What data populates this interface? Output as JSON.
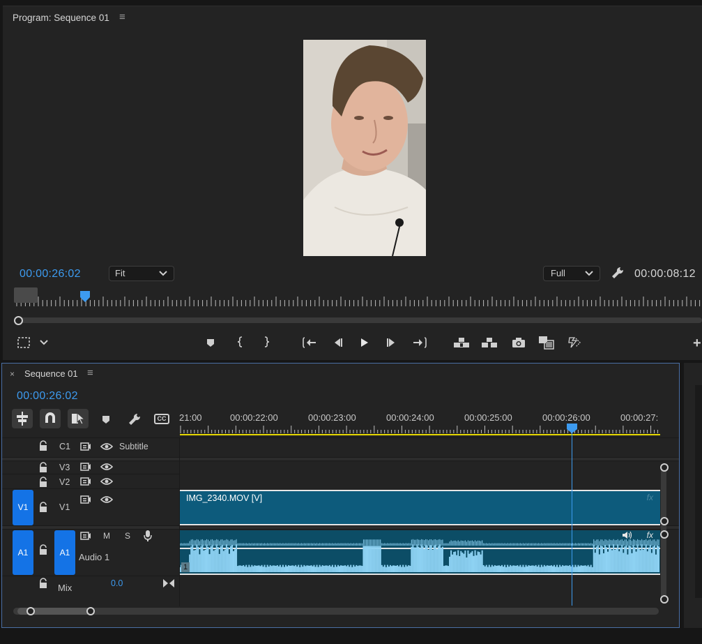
{
  "program": {
    "title": "Program: Sequence 01",
    "current_time": "00:00:26:02",
    "zoom_select": "Fit",
    "resolution_select": "Full",
    "duration": "00:00:08:12",
    "playhead_fraction": 0.105
  },
  "timeline": {
    "sequence_tab": "Sequence 01",
    "current_time": "00:00:26:02",
    "ruler_labels": [
      "21:00",
      "00:00:22:00",
      "00:00:23:00",
      "00:00:24:00",
      "00:00:25:00",
      "00:00:26:00",
      "00:00:27:"
    ],
    "tracks": {
      "c1": {
        "label": "C1",
        "name": "Subtitle"
      },
      "v3": {
        "label": "V3"
      },
      "v2": {
        "label": "V2"
      },
      "v1": {
        "source": "V1",
        "label": "V1"
      },
      "a1": {
        "source": "A1",
        "label": "A1",
        "name": "Audio 1",
        "mute": "M",
        "solo": "S"
      },
      "mix": {
        "name": "Mix",
        "value": "0.0"
      }
    },
    "clips": {
      "video_clip": "IMG_2340.MOV [V]",
      "fx_badge": "fx",
      "audio_fx_badge": "fx",
      "audio_channel": "1"
    },
    "cc_label": "CC"
  },
  "colors": {
    "accent_blue": "#3d9bf0",
    "track_blue": "#1473e6",
    "video_clip": "#0d5b7c",
    "audio_clip": "#0c4d66",
    "waveform": "#8fd3f4",
    "work_area": "#e6d800"
  }
}
